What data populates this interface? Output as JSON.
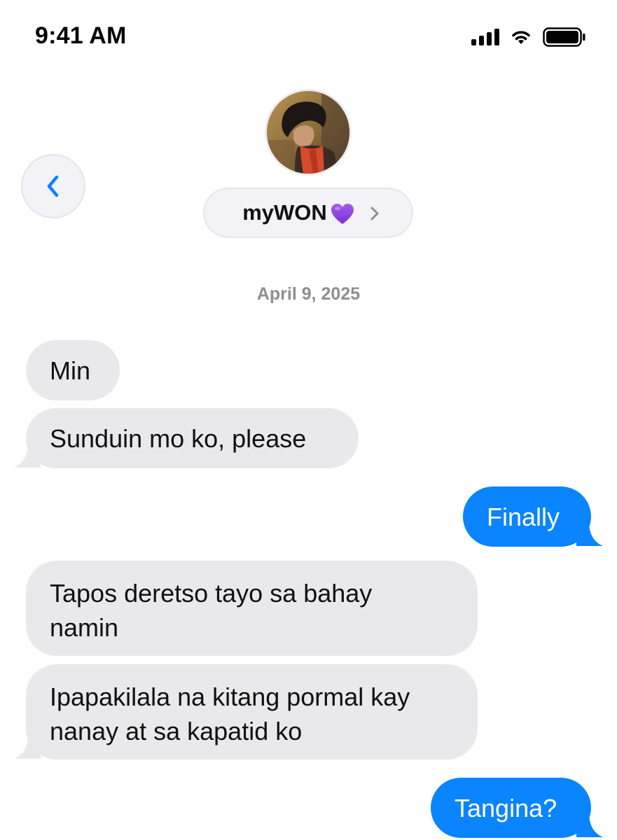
{
  "status_bar": {
    "time": "9:41 AM"
  },
  "header": {
    "back_icon": "chevron-left-icon",
    "contact_name": "myWON",
    "contact_emoji": "purple-heart-icon",
    "details_icon": "chevron-right-icon"
  },
  "conversation": {
    "date": "April 9, 2025",
    "messages": [
      {
        "sender": "them",
        "text": "Min"
      },
      {
        "sender": "them",
        "text": "Sunduin mo ko, please"
      },
      {
        "sender": "me",
        "text": "Finally"
      },
      {
        "sender": "them",
        "line1": "Tapos deretso tayo sa bahay",
        "line2": "namin"
      },
      {
        "sender": "them",
        "line1": "Ipapakilala na kitang pormal kay",
        "line2": "nanay at sa kapatid ko"
      },
      {
        "sender": "me",
        "text": "Tangina?"
      }
    ]
  },
  "colors": {
    "sent_bubble": "#0a84ff",
    "received_bubble": "#e9e9eb",
    "accent": "#0a84ff",
    "date_text": "#8e8e93"
  }
}
